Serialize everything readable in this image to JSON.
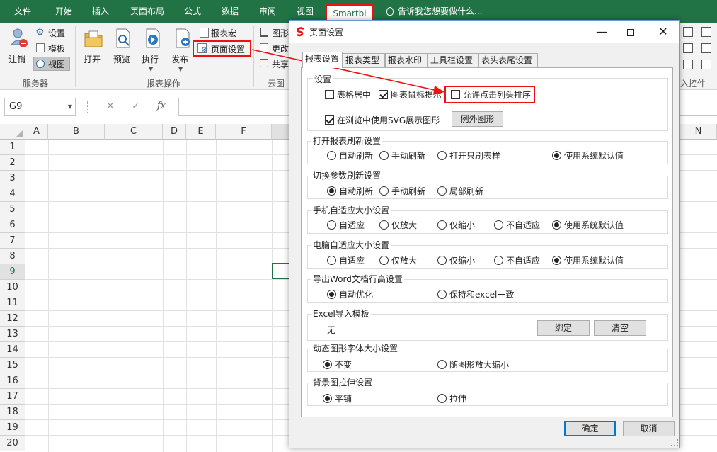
{
  "ribbon_tabs": [
    "文件",
    "开始",
    "插入",
    "页面布局",
    "公式",
    "数据",
    "审阅",
    "视图",
    "Smartbi"
  ],
  "active_tab": "Smartbi",
  "tell_me": "告诉我您想要做什么...",
  "ribbon": {
    "server": {
      "logout": "注销",
      "settings": "设置",
      "template": "模板",
      "view": "视图",
      "group": "服务器"
    },
    "report_ops": {
      "open": "打开",
      "preview": "预览",
      "execute": "执行",
      "publish": "发布",
      "report_macro": "报表宏",
      "page_setup": "页面设置",
      "group": "报表操作"
    },
    "cloud": {
      "chart": "图形",
      "modify": "更改",
      "share": "共享",
      "group_partial": "云图"
    },
    "right_group_partial": "入控件"
  },
  "formula_bar": {
    "name_box": "G9",
    "cancel_icon": "✕",
    "confirm_icon": "✓",
    "fx": "fx"
  },
  "grid": {
    "columns": [
      "A",
      "B",
      "C",
      "D",
      "E",
      "F",
      "N"
    ],
    "rows": [
      "1",
      "2",
      "3",
      "4",
      "5",
      "6",
      "7",
      "8",
      "9",
      "10",
      "11",
      "12",
      "13",
      "14",
      "15",
      "16",
      "17",
      "18",
      "19",
      "20"
    ],
    "selected_row": "9"
  },
  "dialog": {
    "title": "页面设置",
    "tabs": [
      "报表设置",
      "报表类型",
      "报表水印",
      "工具栏设置",
      "表头表尾设置"
    ],
    "active_tab": "报表设置",
    "settings": {
      "title": "设置",
      "center_table": "表格居中",
      "chart_tooltip": "图表鼠标提示",
      "allow_header_sort": "允许点击列头排序",
      "svg_chart": "在浏览中使用SVG展示图形",
      "exception_chart_button": "例外图形"
    },
    "open_refresh": {
      "title": "打开报表刷新设置",
      "options": [
        "自动刷新",
        "手动刷新",
        "打开只刷表样",
        "使用系统默认值"
      ],
      "selected": 3
    },
    "param_refresh": {
      "title": "切换参数刷新设置",
      "options": [
        "自动刷新",
        "手动刷新",
        "局部刷新"
      ],
      "selected": 0
    },
    "mobile_fit": {
      "title": "手机自适应大小设置",
      "options": [
        "自适应",
        "仅放大",
        "仅缩小",
        "不自适应",
        "使用系统默认值"
      ],
      "selected": 4
    },
    "pc_fit": {
      "title": "电脑自适应大小设置",
      "options": [
        "自适应",
        "仅放大",
        "仅缩小",
        "不自适应",
        "使用系统默认值"
      ],
      "selected": 4
    },
    "word_export": {
      "title": "导出Word文档行高设置",
      "options": [
        "自动优化",
        "保持和excel一致"
      ],
      "selected": 0
    },
    "excel_import": {
      "title": "Excel导入模板",
      "value": "无",
      "bind_button": "绑定",
      "clear_button": "清空"
    },
    "dynamic_font": {
      "title": "动态图形字体大小设置",
      "options": [
        "不变",
        "随图形放大缩小"
      ],
      "selected": 0
    },
    "background": {
      "title": "背景图拉伸设置",
      "options": [
        "平铺",
        "拉伸"
      ],
      "selected": 0
    },
    "ok_button": "确定",
    "cancel_button": "取消"
  },
  "colors": {
    "excel_green": "#217346",
    "highlight_red": "#e11111",
    "dialog_border": "#6b9bd2"
  }
}
